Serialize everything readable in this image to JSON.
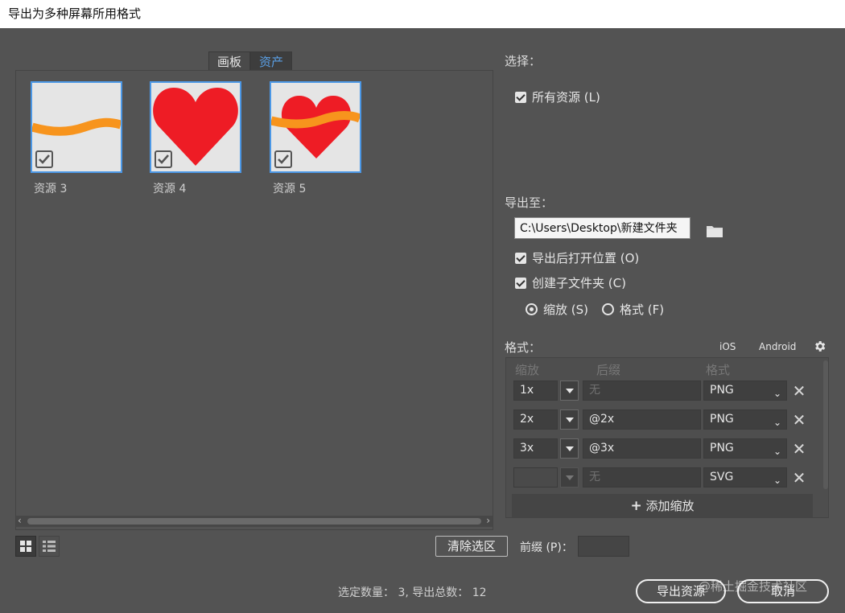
{
  "window": {
    "title": "导出为多种屏幕所用格式"
  },
  "tabs": [
    {
      "label": "画板",
      "active": false
    },
    {
      "label": "资产",
      "active": true
    }
  ],
  "assets": [
    {
      "label": "资源 3",
      "checked": true,
      "icon": "wave-stroke-art"
    },
    {
      "label": "资源 4",
      "checked": true,
      "icon": "heart-art"
    },
    {
      "label": "资源 5",
      "checked": true,
      "icon": "heart-with-band-art"
    }
  ],
  "selection": {
    "title": "选择：",
    "all_assets_label": "所有资源 (L)",
    "all_assets_checked": true
  },
  "export_to": {
    "title": "导出至：",
    "path": "C:\\Users\\Desktop\\新建文件夹",
    "open_after_label": "导出后打开位置 (O)",
    "open_after_checked": true,
    "create_subfolder_label": "创建子文件夹 (C)",
    "create_subfolder_checked": true,
    "by_scale_label": "缩放 (S)",
    "by_format_label": "格式 (F)",
    "selected_mode": "scale"
  },
  "formats": {
    "title": "格式：",
    "ios_label": "iOS",
    "android_label": "Android",
    "col_scale": "缩放",
    "col_suffix": "后缀",
    "col_format": "格式",
    "rows": [
      {
        "scale": "1x",
        "suffix": "无",
        "suffix_placeholder": true,
        "format": "PNG"
      },
      {
        "scale": "2x",
        "suffix": "@2x",
        "suffix_placeholder": false,
        "format": "PNG"
      },
      {
        "scale": "3x",
        "suffix": "@3x",
        "suffix_placeholder": false,
        "format": "PNG"
      },
      {
        "scale": "",
        "suffix": "无",
        "suffix_placeholder": true,
        "format": "SVG"
      }
    ],
    "add_scale_label": "添加缩放"
  },
  "footer": {
    "clear_selection_label": "清除选区",
    "prefix_label": "前缀 (P)：",
    "prefix_value": "",
    "summary": "选定数量： 3, 导出总数： 12",
    "export_label": "导出资源",
    "cancel_label": "取消",
    "watermark": "@稀土掘金技术社区"
  },
  "colors": {
    "accent": "#4c98e6",
    "heart_red": "#ee1c25",
    "band_orange": "#f7941d",
    "panel_bg": "#535353"
  }
}
